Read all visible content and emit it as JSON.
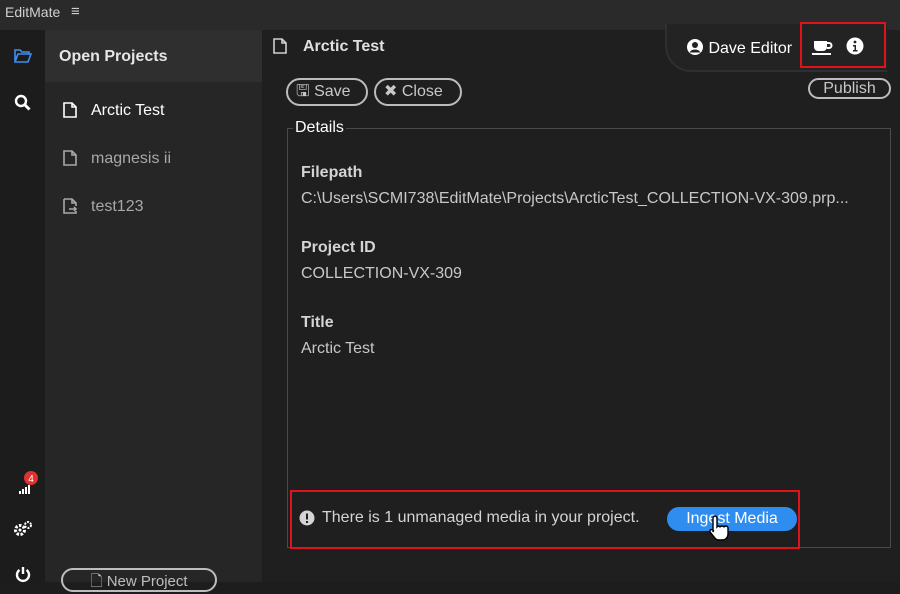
{
  "app": {
    "title": "EditMate"
  },
  "rail": {
    "notification_count": "4"
  },
  "projects": {
    "header": "Open Projects",
    "items": [
      {
        "label": "Arctic Test",
        "active": true
      },
      {
        "label": "magnesis ii",
        "active": false
      },
      {
        "label": "test123",
        "active": false
      }
    ],
    "new_button": "New Project"
  },
  "main": {
    "title": "Arctic Test",
    "user": "Dave Editor",
    "save_label": "Save",
    "close_label": "Close",
    "publish_label": "Publish",
    "details_legend": "Details",
    "fields": {
      "filepath_label": "Filepath",
      "filepath_value": "C:\\Users\\SCMI738\\EditMate\\Projects\\ArcticTest_COLLECTION-VX-309.prp...",
      "project_id_label": "Project ID",
      "project_id_value": "COLLECTION-VX-309",
      "title_label": "Title",
      "title_value": "Arctic Test"
    },
    "warning_text": "There is 1 unmanaged media in your project.",
    "ingest_label": "Ingest Media"
  },
  "colors": {
    "accent": "#2f8df0",
    "highlight": "#e0121b",
    "badge": "#e03030"
  }
}
